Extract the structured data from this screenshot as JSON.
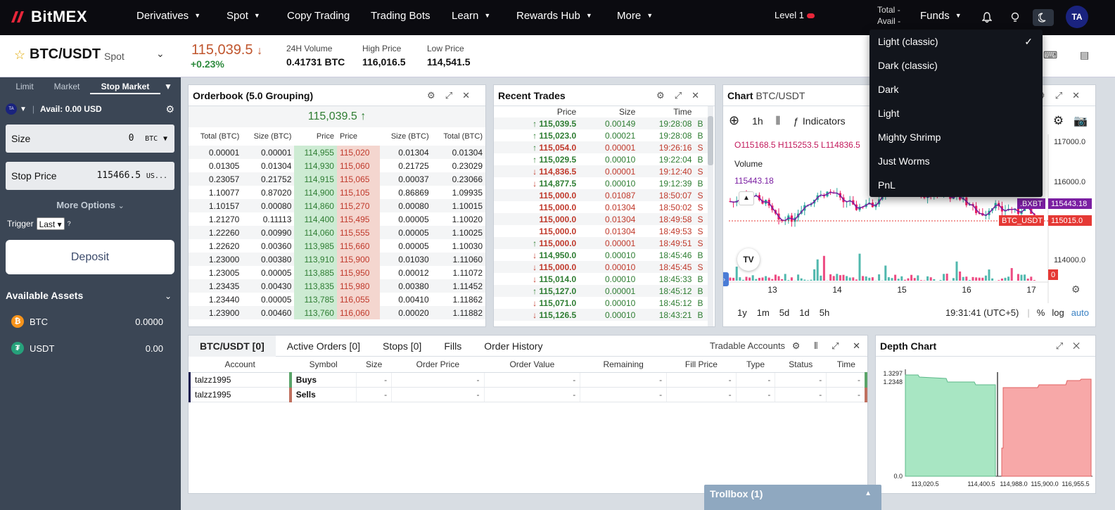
{
  "nav": {
    "logo": "BitMEX",
    "items": [
      {
        "label": "Derivatives",
        "caret": true
      },
      {
        "label": "Spot",
        "caret": true
      },
      {
        "label": "Copy Trading",
        "caret": false
      },
      {
        "label": "Trading Bots",
        "caret": false
      },
      {
        "label": "Learn",
        "caret": true
      },
      {
        "label": "Rewards Hub",
        "caret": true
      },
      {
        "label": "More",
        "caret": true
      }
    ],
    "level": "Level 1",
    "total_label": "Total",
    "total_value": "-",
    "avail_label": "Avail",
    "avail_value": "-",
    "funds": "Funds",
    "avatar": "TA"
  },
  "theme_menu": {
    "items": [
      "Light (classic)",
      "Dark (classic)",
      "Dark",
      "Light",
      "Mighty Shrimp",
      "Just Worms",
      "PnL"
    ],
    "checked": "Light (classic)"
  },
  "symbol": {
    "name": "BTC/USDT",
    "type": "Spot"
  },
  "order_form": {
    "tabs": [
      "Limit",
      "Market",
      "Stop Market"
    ],
    "active_tab": "Stop Market",
    "avatar": "TA",
    "avail": "Avail: 0.00 USD",
    "size_label": "Size",
    "size_value": "0",
    "size_unit": "BTC",
    "stop_label": "Stop Price",
    "stop_value": "115466.5",
    "stop_unit": "US...",
    "more_options": "More Options",
    "trigger_label": "Trigger",
    "trigger_value": "Last",
    "deposit": "Deposit"
  },
  "assets": {
    "title": "Available Assets",
    "items": [
      {
        "name": "BTC",
        "amount": "0.0000",
        "color": "#f7931a",
        "glyph": "₿"
      },
      {
        "name": "USDT",
        "amount": "0.00",
        "color": "#26a17b",
        "glyph": "₮"
      }
    ]
  },
  "ticker": {
    "price": "115,039.5",
    "change": "+0.23%",
    "stats": [
      {
        "label": "24H Volume",
        "value": "0.41731 BTC"
      },
      {
        "label": "High Price",
        "value": "116,016.5"
      },
      {
        "label": "Low Price",
        "value": "114,541.5"
      }
    ]
  },
  "orderbook": {
    "title": "Orderbook (5.0 Grouping)",
    "mid": "115,039.5",
    "headers": [
      "Total (BTC)",
      "Size (BTC)",
      "Price",
      "Price",
      "Size (BTC)",
      "Total (BTC)"
    ],
    "rows": [
      [
        "0.00001",
        "0.00001",
        "114,955",
        "115,020",
        "0.01304",
        "0.01304"
      ],
      [
        "0.01305",
        "0.01304",
        "114,930",
        "115,060",
        "0.21725",
        "0.23029"
      ],
      [
        "0.23057",
        "0.21752",
        "114,915",
        "115,065",
        "0.00037",
        "0.23066"
      ],
      [
        "1.10077",
        "0.87020",
        "114,900",
        "115,105",
        "0.86869",
        "1.09935"
      ],
      [
        "1.10157",
        "0.00080",
        "114,860",
        "115,270",
        "0.00080",
        "1.10015"
      ],
      [
        "1.21270",
        "0.11113",
        "114,400",
        "115,495",
        "0.00005",
        "1.10020"
      ],
      [
        "1.22260",
        "0.00990",
        "114,060",
        "115,555",
        "0.00005",
        "1.10025"
      ],
      [
        "1.22620",
        "0.00360",
        "113,985",
        "115,660",
        "0.00005",
        "1.10030"
      ],
      [
        "1.23000",
        "0.00380",
        "113,910",
        "115,900",
        "0.01030",
        "1.11060"
      ],
      [
        "1.23005",
        "0.00005",
        "113,885",
        "115,950",
        "0.00012",
        "1.11072"
      ],
      [
        "1.23435",
        "0.00430",
        "113,835",
        "115,980",
        "0.00380",
        "1.11452"
      ],
      [
        "1.23440",
        "0.00005",
        "113,785",
        "116,055",
        "0.00410",
        "1.11862"
      ],
      [
        "1.23900",
        "0.00460",
        "113,760",
        "116,060",
        "0.00020",
        "1.11882"
      ]
    ]
  },
  "recent_trades": {
    "title": "Recent Trades",
    "headers": [
      "Price",
      "Size",
      "Time"
    ],
    "rows": [
      {
        "dir": "up",
        "price": "115,039.5",
        "size": "0.00149",
        "time": "19:28:08",
        "side": "B"
      },
      {
        "dir": "up",
        "price": "115,023.0",
        "size": "0.00021",
        "time": "19:28:08",
        "side": "B"
      },
      {
        "dir": "up",
        "price": "115,054.0",
        "size": "0.00001",
        "time": "19:26:16",
        "side": "S"
      },
      {
        "dir": "up",
        "price": "115,029.5",
        "size": "0.00010",
        "time": "19:22:04",
        "side": "B"
      },
      {
        "dir": "dn",
        "price": "114,836.5",
        "size": "0.00001",
        "time": "19:12:40",
        "side": "S"
      },
      {
        "dir": "dn",
        "price": "114,877.5",
        "size": "0.00010",
        "time": "19:12:39",
        "side": "B"
      },
      {
        "dir": "",
        "price": "115,000.0",
        "size": "0.01087",
        "time": "18:50:07",
        "side": "S"
      },
      {
        "dir": "",
        "price": "115,000.0",
        "size": "0.01304",
        "time": "18:50:02",
        "side": "S"
      },
      {
        "dir": "",
        "price": "115,000.0",
        "size": "0.01304",
        "time": "18:49:58",
        "side": "S"
      },
      {
        "dir": "",
        "price": "115,000.0",
        "size": "0.01304",
        "time": "18:49:53",
        "side": "S"
      },
      {
        "dir": "up",
        "price": "115,000.0",
        "size": "0.00001",
        "time": "18:49:51",
        "side": "S"
      },
      {
        "dir": "dn",
        "price": "114,950.0",
        "size": "0.00010",
        "time": "18:45:46",
        "side": "B"
      },
      {
        "dir": "dn",
        "price": "115,000.0",
        "size": "0.00010",
        "time": "18:45:45",
        "side": "S"
      },
      {
        "dir": "dn",
        "price": "115,014.0",
        "size": "0.00010",
        "time": "18:45:33",
        "side": "B"
      },
      {
        "dir": "up",
        "price": "115,127.0",
        "size": "0.00001",
        "time": "18:45:12",
        "side": "B"
      },
      {
        "dir": "dn",
        "price": "115,071.0",
        "size": "0.00010",
        "time": "18:45:12",
        "side": "B"
      },
      {
        "dir": "dn",
        "price": "115,126.5",
        "size": "0.00010",
        "time": "18:43:21",
        "side": "B"
      }
    ]
  },
  "chart": {
    "title": "Chart",
    "symbol": "BTC/USDT",
    "interval": "1h",
    "indicators": "Indicators",
    "ohlc_o": "O115168.5",
    "ohlc_h": "H115253.5",
    "ohlc_l": "L114836.5",
    "volume_label": "Volume",
    "last_tag": "115443.18",
    "y_ticks": [
      "117000.0",
      "116000.0",
      "114000.0"
    ],
    "x_ticks": [
      "13",
      "14",
      "15",
      "16",
      "17"
    ],
    "tag_bxbt": ".BXBT",
    "tag_bxbt_val": "115443.18",
    "tag_btc": "BTC_USDT",
    "tag_btc_val": "115015.0",
    "vol_tag": "0",
    "ranges": [
      "1y",
      "1m",
      "5d",
      "1d",
      "5h"
    ],
    "time": "19:31:41 (UTC+5)",
    "pct": "%",
    "log": "log",
    "auto": "auto",
    "colors": {
      "up": "#26a69a",
      "down": "#e91e63",
      "line": "#7b1fa2"
    }
  },
  "orders": {
    "tabs": [
      "BTC/USDT [0]",
      "Active Orders [0]",
      "Stops [0]",
      "Fills",
      "Order History"
    ],
    "tradable": "Tradable Accounts",
    "headers": [
      "Account",
      "Symbol",
      "Size",
      "Order Price",
      "Order Value",
      "Remaining",
      "Fill Price",
      "Type",
      "Status",
      "Time"
    ],
    "rows": [
      {
        "account": "talzz1995",
        "symbol": "Buys",
        "color": "#5aa469"
      },
      {
        "account": "talzz1995",
        "symbol": "Sells",
        "color": "#c0705f"
      }
    ],
    "empty": "-"
  },
  "depth": {
    "title": "Depth Chart",
    "y_ticks": [
      "1.3297",
      "1.2348",
      "0.0"
    ],
    "x_ticks": [
      "113,020.5",
      "114,400.5",
      "114,988.0",
      "115,900.0",
      "116,955.5"
    ]
  },
  "trollbox": "Trollbox (1)"
}
